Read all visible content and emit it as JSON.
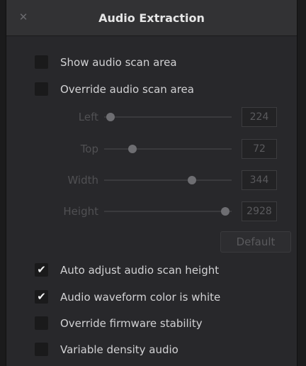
{
  "window": {
    "title": "Audio Extraction"
  },
  "checkboxes": [
    {
      "label": "Show audio scan area",
      "checked": false,
      "mark": ""
    },
    {
      "label": "Override audio scan area",
      "checked": false,
      "mark": ""
    },
    {
      "label": "Auto adjust audio scan height",
      "checked": true,
      "mark": "✔"
    },
    {
      "label": "Audio waveform color is white",
      "checked": true,
      "mark": "✔"
    },
    {
      "label": "Override firmware stability",
      "checked": false,
      "mark": ""
    },
    {
      "label": "Variable density audio",
      "checked": false,
      "mark": ""
    }
  ],
  "sliders": [
    {
      "label": "Left",
      "value": "224",
      "level": 0.05
    },
    {
      "label": "Top",
      "value": "72",
      "level": 0.22
    },
    {
      "label": "Width",
      "value": "344",
      "level": 0.69
    },
    {
      "label": "Height",
      "value": "2928",
      "level": 0.95
    }
  ],
  "default_button": {
    "label": "Default"
  },
  "icons": {
    "close": "close-icon"
  },
  "colors": {
    "background": "#28282b",
    "titlebar": "#323234",
    "text": "#d2d2d4",
    "disabled_text": "#505053"
  }
}
